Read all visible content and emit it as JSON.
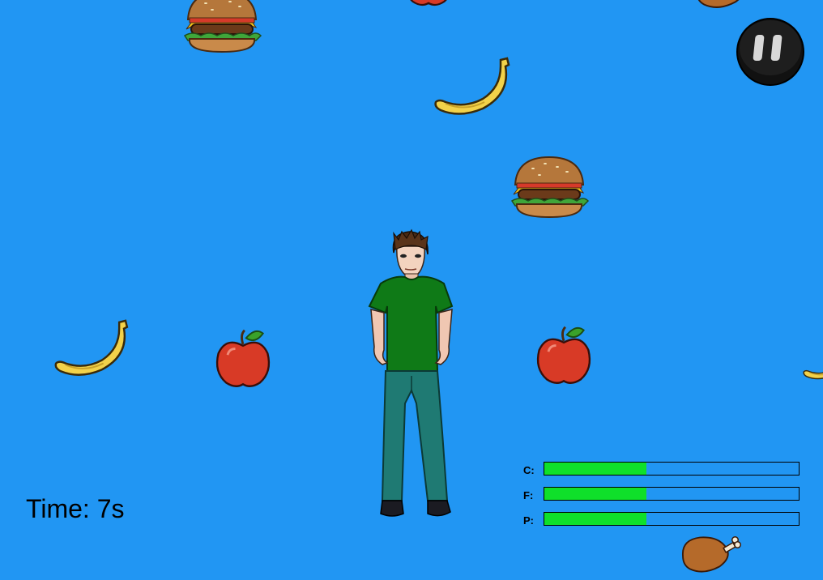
{
  "game": {
    "timer_label": "Time: 7s",
    "background_color": "#2196f3"
  },
  "hud": {
    "bars": [
      {
        "label": "C:",
        "level": 0.4,
        "color": "#0fe02a"
      },
      {
        "label": "F:",
        "level": 0.4,
        "color": "#0fe02a"
      },
      {
        "label": "P:",
        "level": 0.4,
        "color": "#0fe02a"
      }
    ]
  },
  "pause_button": {
    "icon": "pause-icon"
  },
  "falling_items": [
    {
      "kind": "burger"
    },
    {
      "kind": "apple"
    },
    {
      "kind": "drumstick"
    },
    {
      "kind": "banana"
    },
    {
      "kind": "burger"
    },
    {
      "kind": "banana"
    },
    {
      "kind": "apple"
    },
    {
      "kind": "apple"
    },
    {
      "kind": "banana"
    },
    {
      "kind": "drumstick"
    }
  ],
  "player": {
    "icon": "player-character"
  }
}
